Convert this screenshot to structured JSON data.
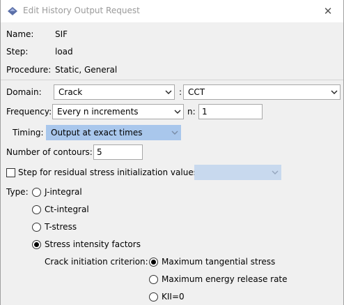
{
  "window": {
    "title": "Edit History Output Request",
    "close_glyph": "✕",
    "icon": "diamond-app-icon"
  },
  "info": {
    "name_label": "Name:",
    "name_value": "SIF",
    "step_label": "Step:",
    "step_value": "load",
    "procedure_label": "Procedure:",
    "procedure_value": "Static, General"
  },
  "domain": {
    "label": "Domain:",
    "value": "Crack",
    "separator": ":",
    "sub_value": "CCT"
  },
  "frequency": {
    "label": "Frequency:",
    "value": "Every n increments",
    "n_label": "n:",
    "n_value": "1"
  },
  "timing": {
    "label": "Timing:",
    "value": "Output at exact times"
  },
  "contours": {
    "label": "Number of contours:",
    "value": "5"
  },
  "residual": {
    "label": "Step for residual stress initialization values:",
    "checked": false,
    "value": ""
  },
  "type": {
    "label": "Type:",
    "options": [
      {
        "label": "J-integral",
        "checked": false
      },
      {
        "label": "Ct-integral",
        "checked": false
      },
      {
        "label": "T-stress",
        "checked": false
      },
      {
        "label": "Stress intensity factors",
        "checked": true
      }
    ]
  },
  "criterion": {
    "label": "Crack initiation criterion:",
    "options": [
      {
        "label": "Maximum tangential stress",
        "checked": true
      },
      {
        "label": "Maximum energy release rate",
        "checked": false
      },
      {
        "label": "KII=0",
        "checked": false
      }
    ]
  },
  "colors": {
    "selected_combo": "#a9c7ec",
    "disabled_combo": "#c8d9ee",
    "title_text": "#9a9a9a"
  }
}
